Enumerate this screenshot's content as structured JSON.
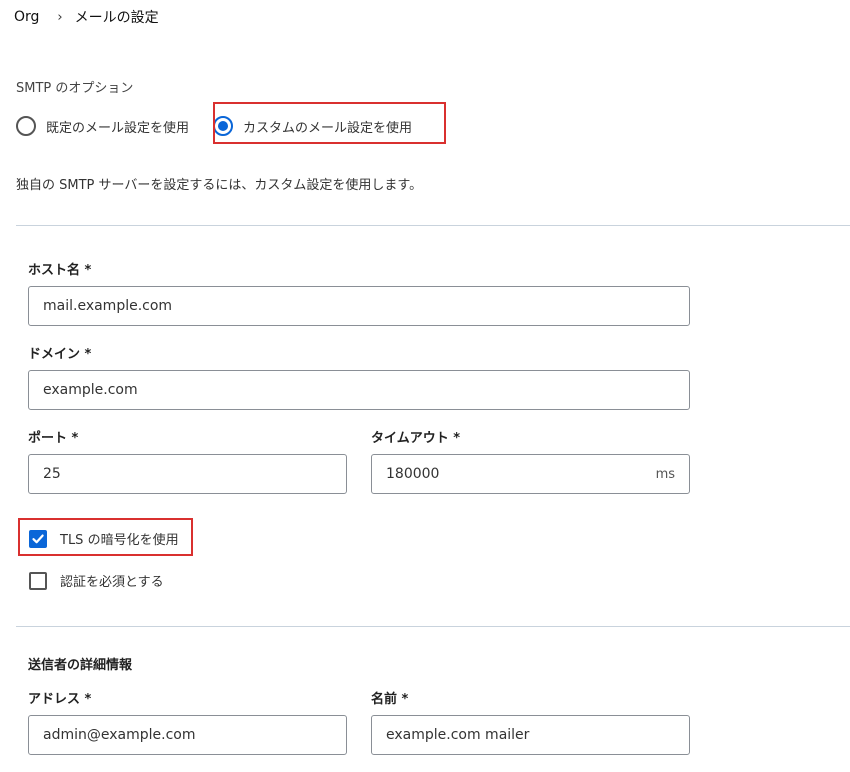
{
  "breadcrumb": {
    "root": "Org",
    "separator": "›",
    "current": "メールの設定"
  },
  "smtp": {
    "label": "SMTP のオプション",
    "options": [
      {
        "label": "既定のメール設定を使用",
        "selected": false
      },
      {
        "label": "カスタムのメール設定を使用",
        "selected": true
      }
    ],
    "description": "独自の SMTP サーバーを設定するには、カスタム設定を使用します。"
  },
  "server": {
    "host": {
      "label": "ホスト名 *",
      "value": "mail.example.com"
    },
    "domain": {
      "label": "ドメイン *",
      "value": "example.com"
    },
    "port": {
      "label": "ポート *",
      "value": "25"
    },
    "timeout": {
      "label": "タイムアウト *",
      "value": "180000",
      "unit": "ms"
    }
  },
  "options": {
    "tls": {
      "label": "TLS の暗号化を使用",
      "checked": true
    },
    "auth": {
      "label": "認証を必須とする",
      "checked": false
    }
  },
  "sender": {
    "heading": "送信者の詳細情報",
    "address": {
      "label": "アドレス *",
      "value": "admin@example.com"
    },
    "name": {
      "label": "名前 *",
      "value": "example.com mailer"
    }
  },
  "colors": {
    "accent": "#0a66d8",
    "highlight": "#d9302f"
  }
}
